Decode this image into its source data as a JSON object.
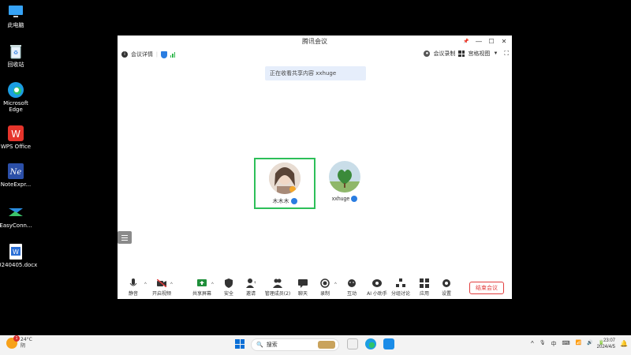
{
  "desktop": {
    "icons": [
      {
        "label": "此电脑",
        "icon": "monitor-icon"
      },
      {
        "label": "回收站",
        "icon": "recycle-bin-icon"
      },
      {
        "label": "Microsoft Edge",
        "icon": "edge-icon"
      },
      {
        "label": "WPS Office",
        "icon": "wps-icon"
      },
      {
        "label": "NoteExpr...",
        "icon": "noteexpress-icon"
      },
      {
        "label": "EasyConn...",
        "icon": "easyconnect-icon"
      },
      {
        "label": "20240405.docx",
        "icon": "word-doc-icon"
      }
    ]
  },
  "window": {
    "title": "腾讯会议",
    "controls": {
      "pin": "📌",
      "minimize": "—",
      "maximize": "☐",
      "close": "✕"
    }
  },
  "infobar": {
    "meeting_info": "会议详情",
    "recording": "会议录制",
    "view": "宫格视图"
  },
  "notice": "正在收看共享内容 xxhuge",
  "participants": [
    {
      "name": "木木木",
      "active": true
    },
    {
      "name": "xxhuge",
      "active": false
    }
  ],
  "toolbar": {
    "items": [
      {
        "label": "静音",
        "icon": "microphone-icon"
      },
      {
        "label": "开启视频",
        "icon": "camera-off-icon"
      },
      {
        "label": "共享屏幕",
        "icon": "share-screen-icon"
      },
      {
        "label": "安全",
        "icon": "shield-icon"
      },
      {
        "label": "邀请",
        "icon": "invite-user-icon"
      },
      {
        "label": "管理成员(2)",
        "icon": "members-icon"
      },
      {
        "label": "聊天",
        "icon": "chat-icon"
      },
      {
        "label": "录制",
        "icon": "record-icon"
      },
      {
        "label": "互动",
        "icon": "reaction-icon"
      },
      {
        "label": "AI 小助手",
        "icon": "ai-assistant-icon"
      },
      {
        "label": "分组讨论",
        "icon": "breakout-icon"
      },
      {
        "label": "应用",
        "icon": "apps-icon"
      },
      {
        "label": "设置",
        "icon": "gear-icon"
      }
    ],
    "end_label": "结束会议"
  },
  "taskbar": {
    "weather_badge": "1",
    "weather_line1": "24°C",
    "weather_line2": "阴",
    "search_placeholder": "搜索",
    "tray": [
      "^",
      "🎙",
      "中",
      "⌨",
      "📶",
      "🔊",
      "🔋"
    ],
    "time": "23:07",
    "date": "2024/4/5"
  }
}
